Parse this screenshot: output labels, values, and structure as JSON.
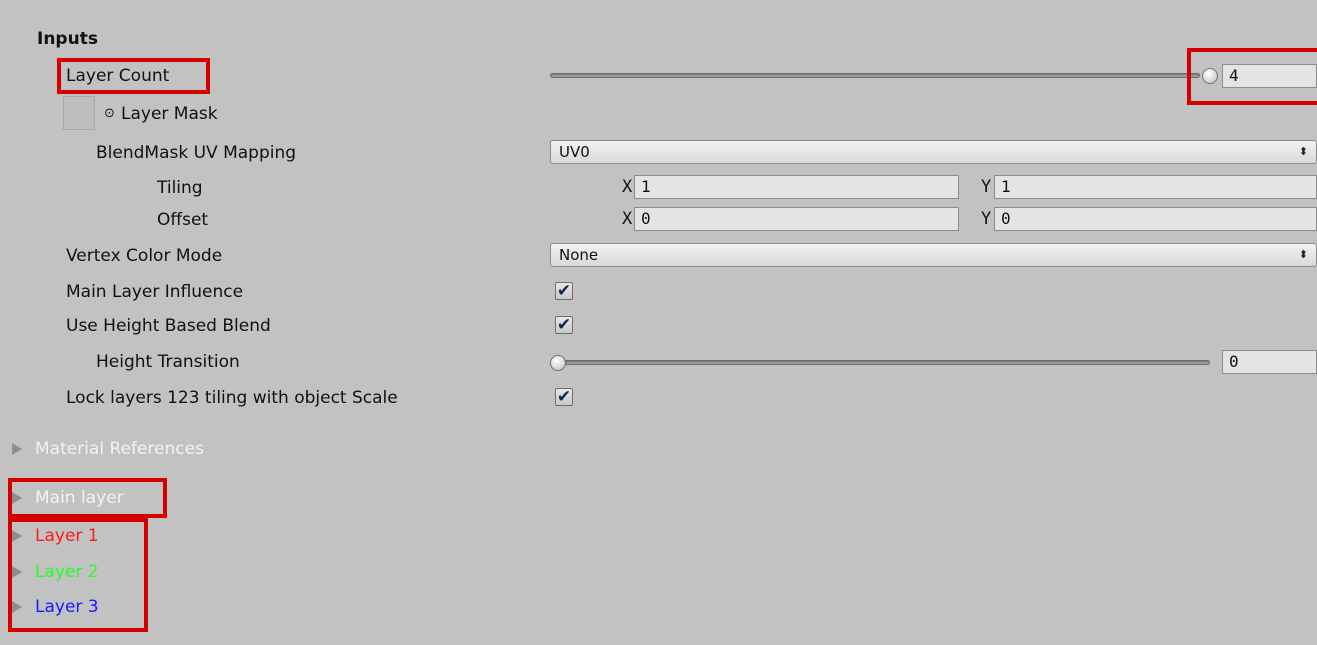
{
  "inputs": {
    "title": "Inputs",
    "layer_count": {
      "label": "Layer Count",
      "value": "4",
      "slider_fraction": 1.0
    },
    "layer_mask": {
      "label": "Layer Mask"
    },
    "blendmask_uv": {
      "label": "BlendMask UV Mapping",
      "selected": "UV0"
    },
    "tiling": {
      "label": "Tiling",
      "x_axis": "X",
      "x": "1",
      "y_axis": "Y",
      "y": "1"
    },
    "offset": {
      "label": "Offset",
      "x_axis": "X",
      "x": "0",
      "y_axis": "Y",
      "y": "0"
    },
    "vertex_color_mode": {
      "label": "Vertex Color Mode",
      "selected": "None"
    },
    "main_layer_influence": {
      "label": "Main Layer Influence",
      "checked": true
    },
    "use_height_blend": {
      "label": "Use Height Based Blend",
      "checked": true
    },
    "height_transition": {
      "label": "Height Transition",
      "value": "0",
      "slider_fraction": 0.0
    },
    "lock_layers": {
      "label": "Lock layers  123 tiling with object Scale",
      "checked": true
    },
    "check_glyph": "✔",
    "dropdown_arrows": "⬍"
  },
  "foldouts": {
    "material_references": {
      "label": "Material References",
      "color": "#f2f2f2"
    },
    "main_layer": {
      "label": "Main layer",
      "color": "#f2f2f2"
    },
    "layer1": {
      "label": "Layer 1",
      "color": "#ff1a1a"
    },
    "layer2": {
      "label": "Layer 2",
      "color": "#22ff22"
    },
    "layer3": {
      "label": "Layer 3",
      "color": "#1a1aff"
    }
  },
  "highlight_color": "#d40000"
}
